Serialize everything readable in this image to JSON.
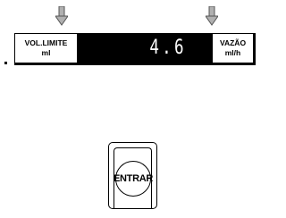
{
  "left_softkey": {
    "line1": "VOL.LIMITE",
    "line2": "ml"
  },
  "right_softkey": {
    "line1": "VAZÃO",
    "line2": "ml/h"
  },
  "display": {
    "value": "4.6"
  },
  "enter_button": {
    "label": "ENTRAR"
  },
  "icons": {
    "left_arrow": "arrow-down-icon",
    "right_arrow": "arrow-down-icon"
  },
  "colors": {
    "display_bg": "#000000",
    "display_text": "#ffffff",
    "arrow_fill": "#b0b0b0"
  }
}
